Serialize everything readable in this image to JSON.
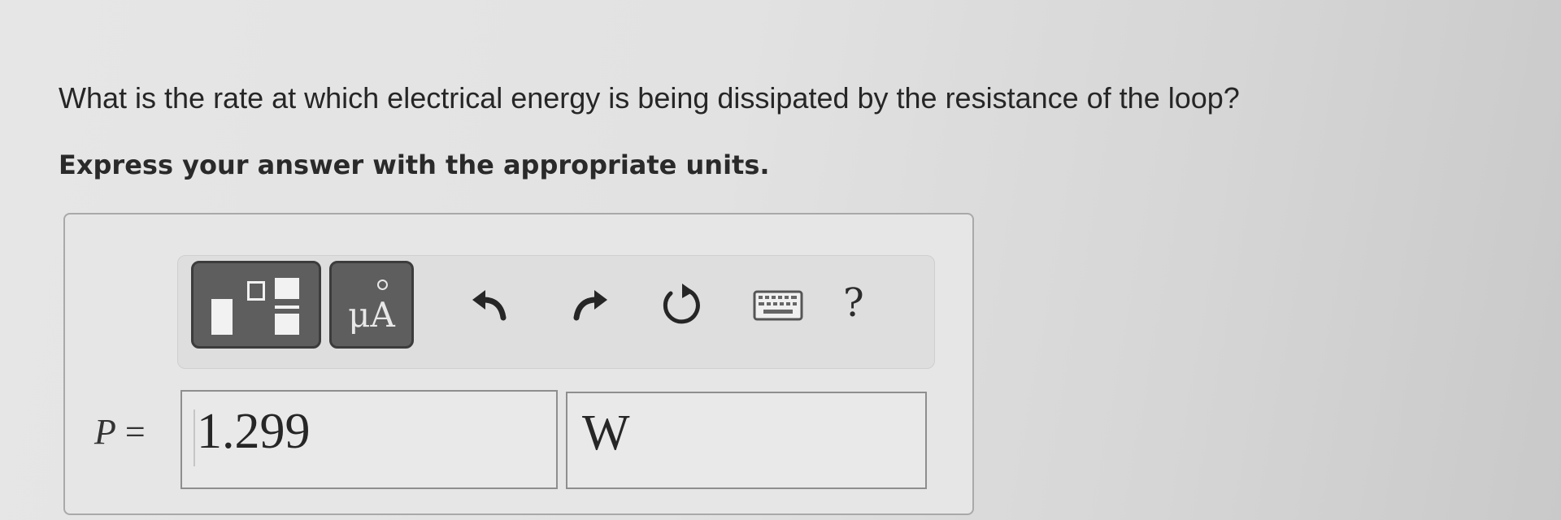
{
  "question": {
    "prompt": "What is the rate at which electrical energy is being dissipated by the resistance of the loop?",
    "instruction": "Express your answer with the appropriate units."
  },
  "toolbar": {
    "templates_icon": "fraction-templates-icon",
    "units_label": "μA",
    "undo_icon": "undo-arrow-icon",
    "redo_icon": "redo-arrow-icon",
    "reset_icon": "reset-icon",
    "keyboard_icon": "keyboard-icon",
    "help_label": "?"
  },
  "answer": {
    "variable": "P",
    "equals": "=",
    "value": "1.299",
    "units": "W"
  },
  "colors": {
    "button_fill": "#5e5e5e",
    "button_border": "#3c3c3c",
    "text": "#262626"
  }
}
